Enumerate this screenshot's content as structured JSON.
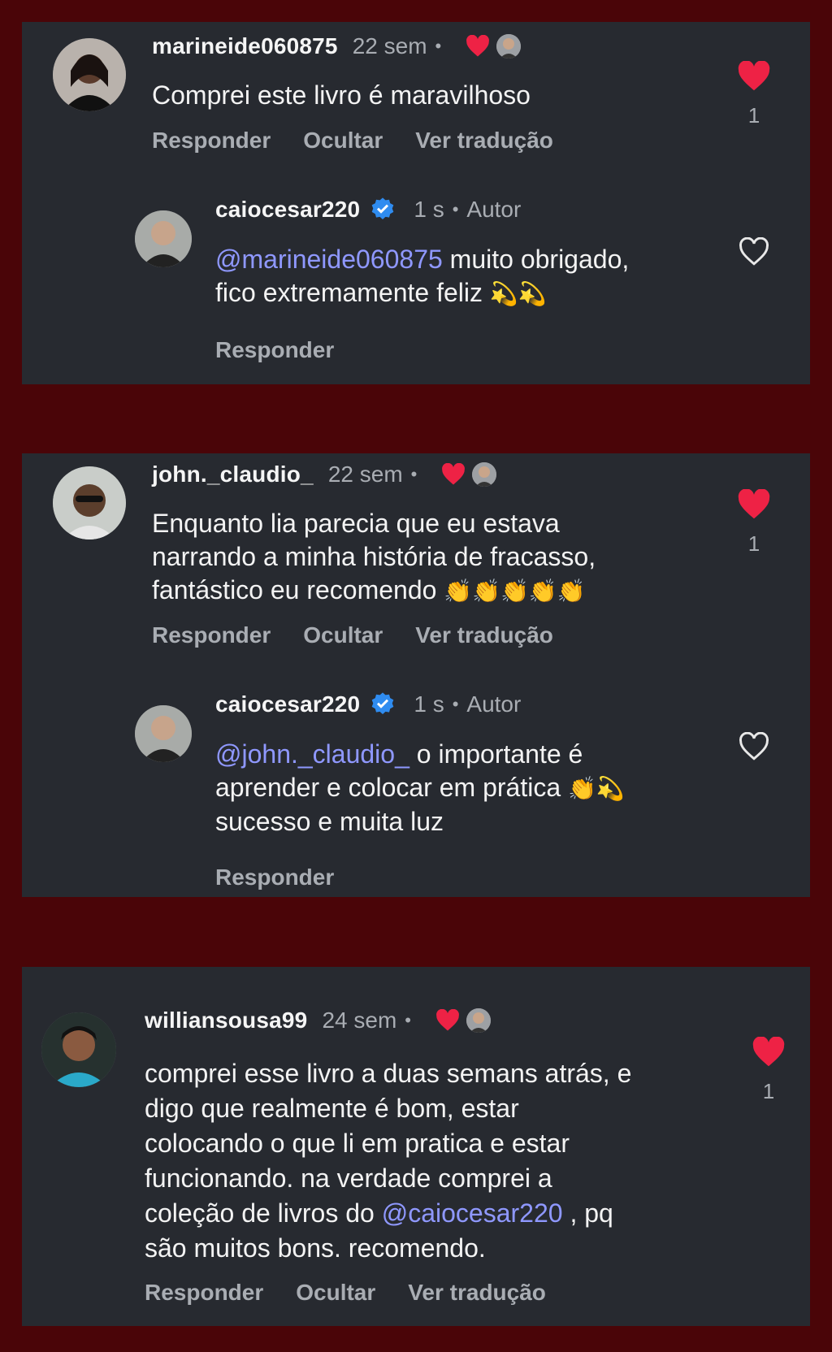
{
  "colors": {
    "background": "#4a0508",
    "card": "#272a30",
    "mention": "#8f98ff",
    "heart": "#ee2245",
    "muted": "#a9adb3"
  },
  "comments": [
    {
      "username": "marineide060875",
      "time": "22 sem",
      "text": "Comprei este livro é maravilhoso",
      "likes": "1",
      "actions": [
        "Responder",
        "Ocultar",
        "Ver tradução"
      ],
      "reply": {
        "username": "caiocesar220",
        "time": "1 s",
        "badge": "Autor",
        "mention": "@marineide060875",
        "text_after": " muito obrigado,",
        "text_line2": "fico extremamente feliz ",
        "emoji": "💫💫",
        "action": "Responder"
      }
    },
    {
      "username": "john._claudio_",
      "time": "22 sem",
      "text_lines": [
        "Enquanto lia parecia que eu estava",
        "narrando a minha história de fracasso,",
        "fantástico eu recomendo "
      ],
      "emoji": "👏👏👏👏👏",
      "likes": "1",
      "actions": [
        "Responder",
        "Ocultar",
        "Ver tradução"
      ],
      "reply": {
        "username": "caiocesar220",
        "time": "1 s",
        "badge": "Autor",
        "mention": "@john._claudio_",
        "text_after": " o importante é",
        "text_line2": "aprender e colocar em prática ",
        "emoji": "👏💫",
        "text_line3": "sucesso e muita luz",
        "action": "Responder"
      }
    },
    {
      "username": "williansousa99",
      "time": "24 sem",
      "text_lines": [
        "comprei esse livro a duas semans atrás, e",
        "digo que realmente é bom, estar",
        "colocando o que li em pratica e estar",
        "funcionando. na verdade comprei a"
      ],
      "line5_before": "coleção de livros do ",
      "line5_mention": "@caiocesar220",
      "line5_after": " , pq",
      "line6": "são muitos bons. recomendo.",
      "likes": "1",
      "actions": [
        "Responder",
        "Ocultar",
        "Ver tradução"
      ]
    }
  ]
}
